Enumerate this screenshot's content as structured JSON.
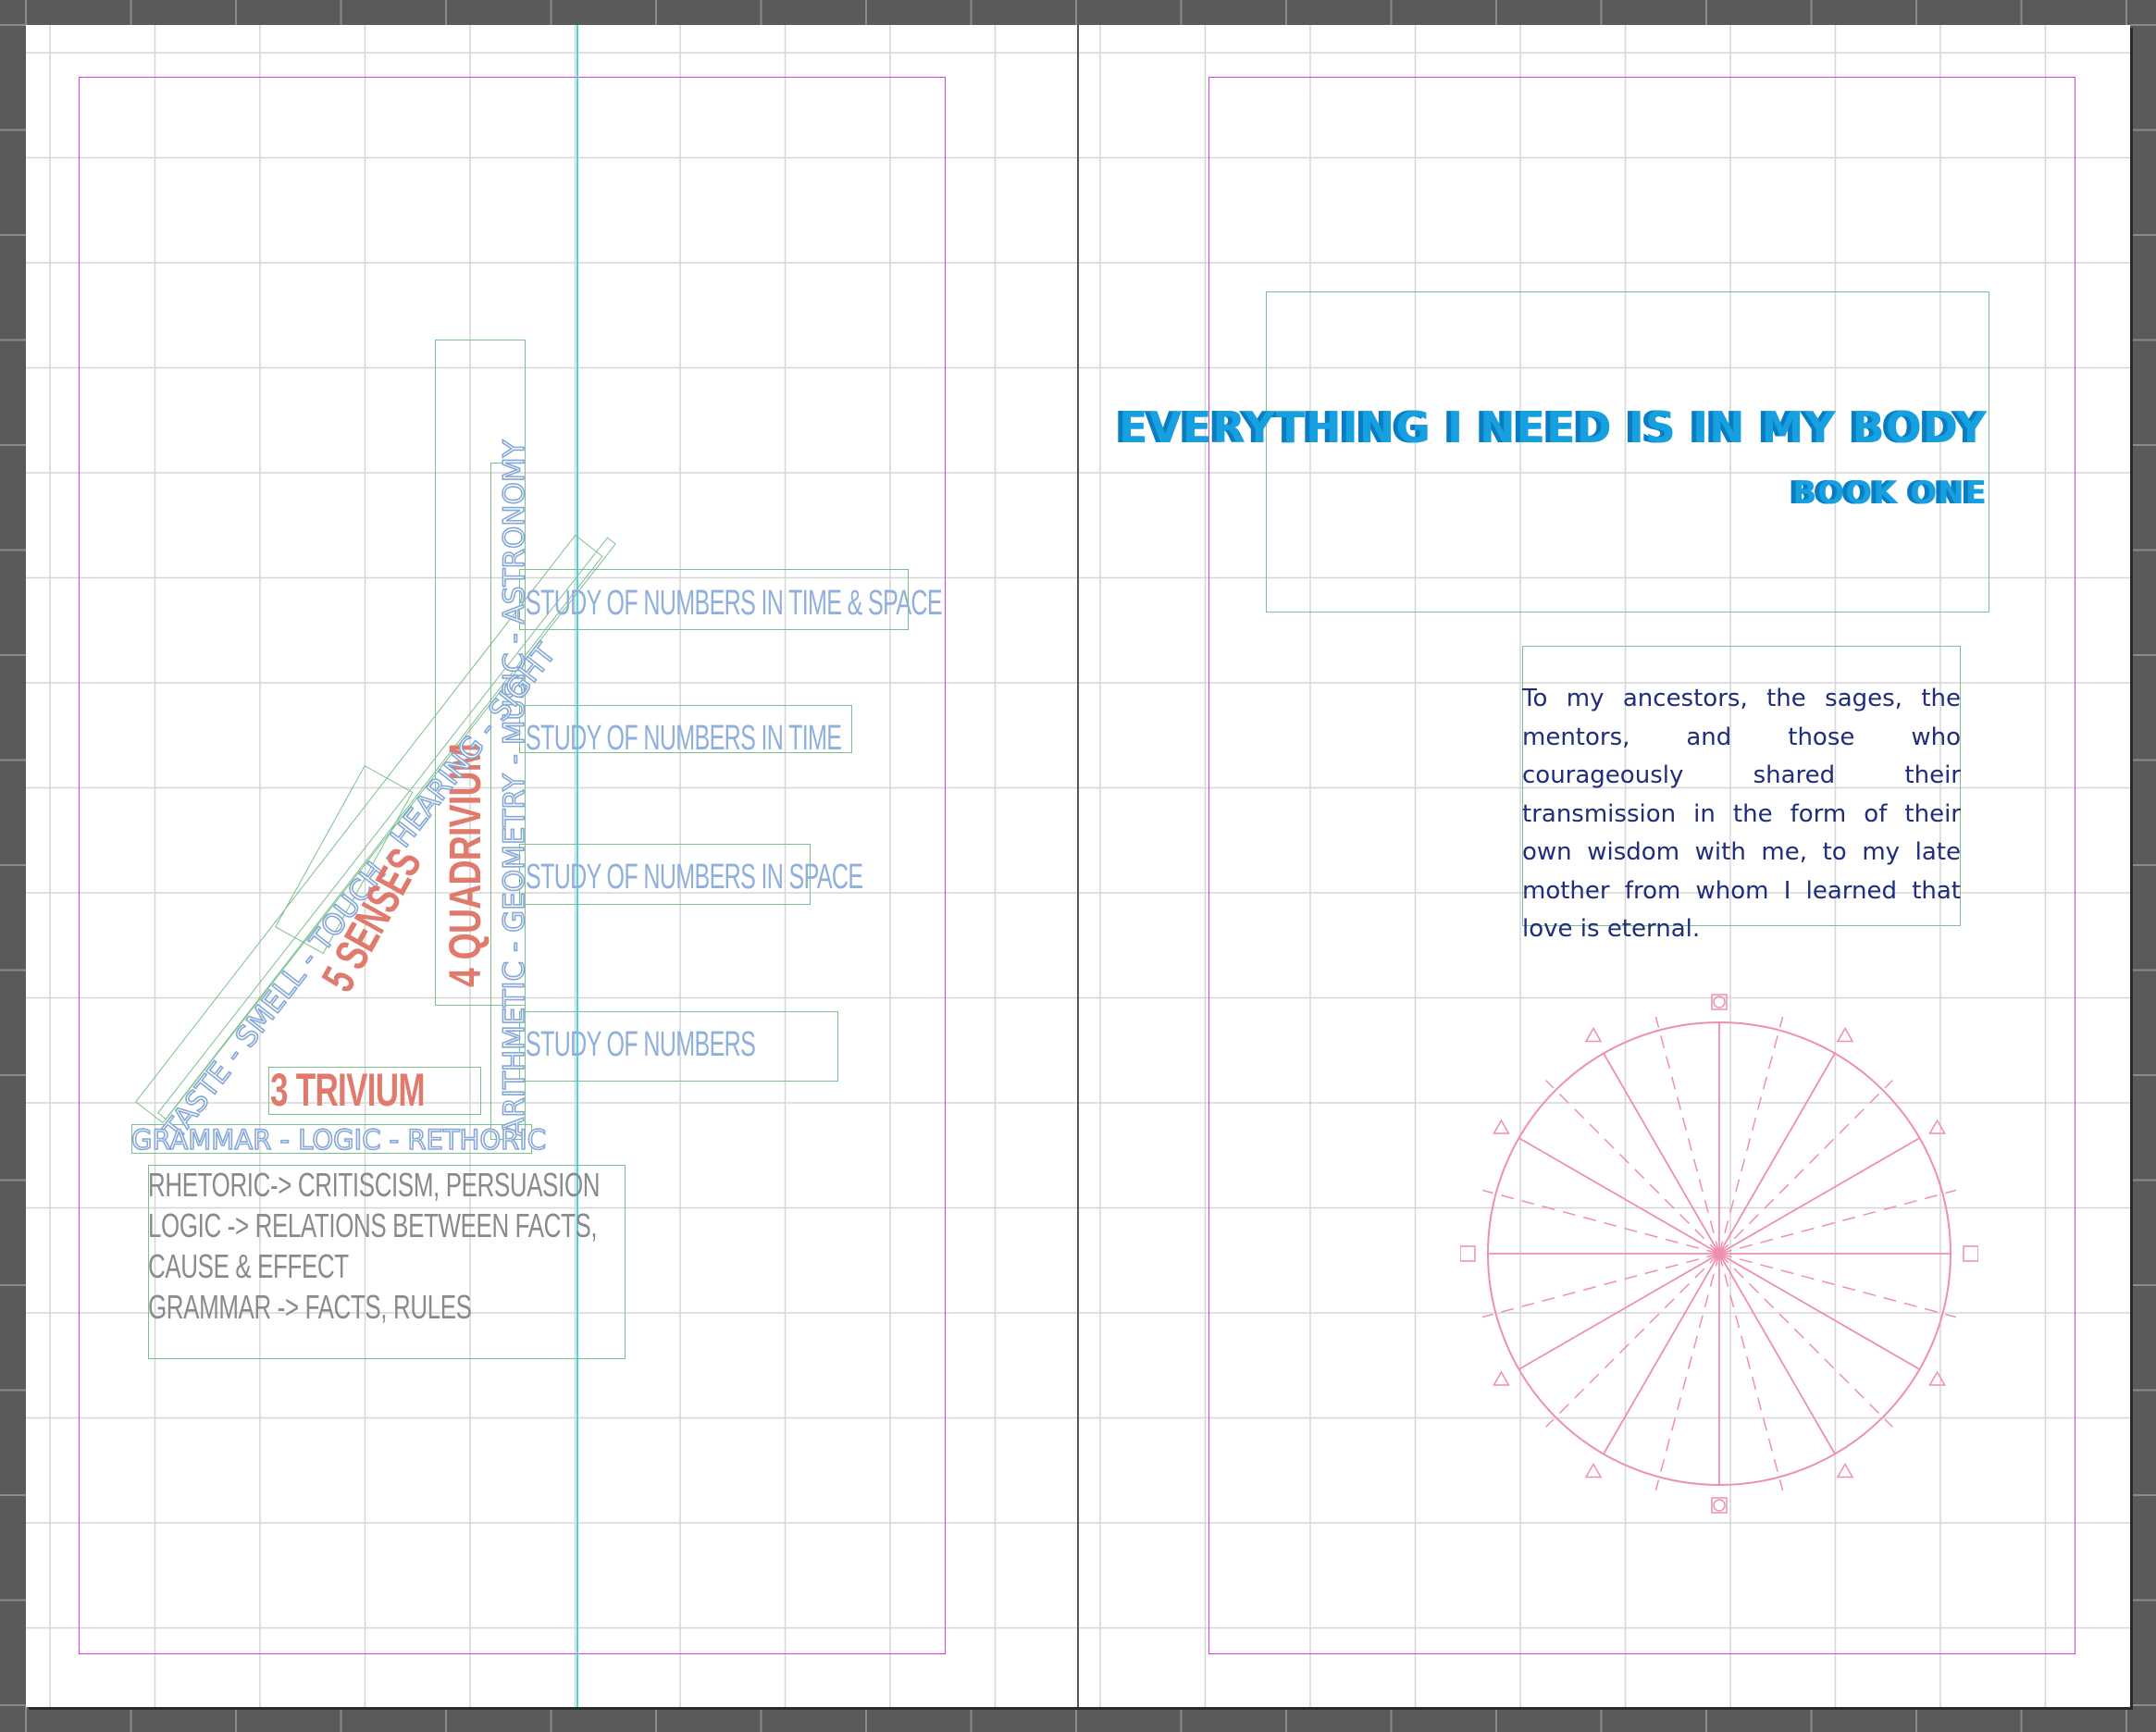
{
  "left_page": {
    "quadrivium_subjects": "ARITHMETIC - GEOMETRY - MUSIC - ASTRONOMY",
    "quadrivium_title": "4 QUADRIVIUM",
    "senses_list": "TASTE - SMELL - TOUCH - HEARING - SIGHT",
    "senses_title": "5 SENSES",
    "trivium_title": "3 TRIVIUM",
    "trivium_subjects": "GRAMMAR - LOGIC - RETHORIC",
    "study_labels": [
      "STUDY OF NUMBERS IN TIME & SPACE",
      "STUDY OF NUMBERS IN TIME",
      "STUDY OF NUMBERS IN SPACE",
      "STUDY OF NUMBERS"
    ],
    "notes": [
      "RHETORIC-> CRITISCISM, PERSUASION",
      "LOGIC -> RELATIONS BETWEEN FACTS,",
      "CAUSE & EFFECT",
      "GRAMMAR -> FACTS, RULES"
    ]
  },
  "right_page": {
    "title": "EVERYTHING I NEED IS IN MY BODY",
    "subtitle": "BOOK ONE",
    "dedication": "To my ancestors, the sages, the mentors, and those who courageously shared their transmission in the form of their own wisdom with me, to my late mother from whom I learned that love is eternal."
  },
  "colors": {
    "pasteboard": "#5a5a5a",
    "frame_edge": "#7cc08d",
    "margin_guide": "#d53fe0",
    "column_guide": "#40d8e8",
    "title_blue": "#16a0e0",
    "accent_red": "#e07a6c",
    "label_blue": "#8fb0dd",
    "dedication_navy": "#1f2d7a",
    "wheel_pink": "#ef8fb0"
  }
}
